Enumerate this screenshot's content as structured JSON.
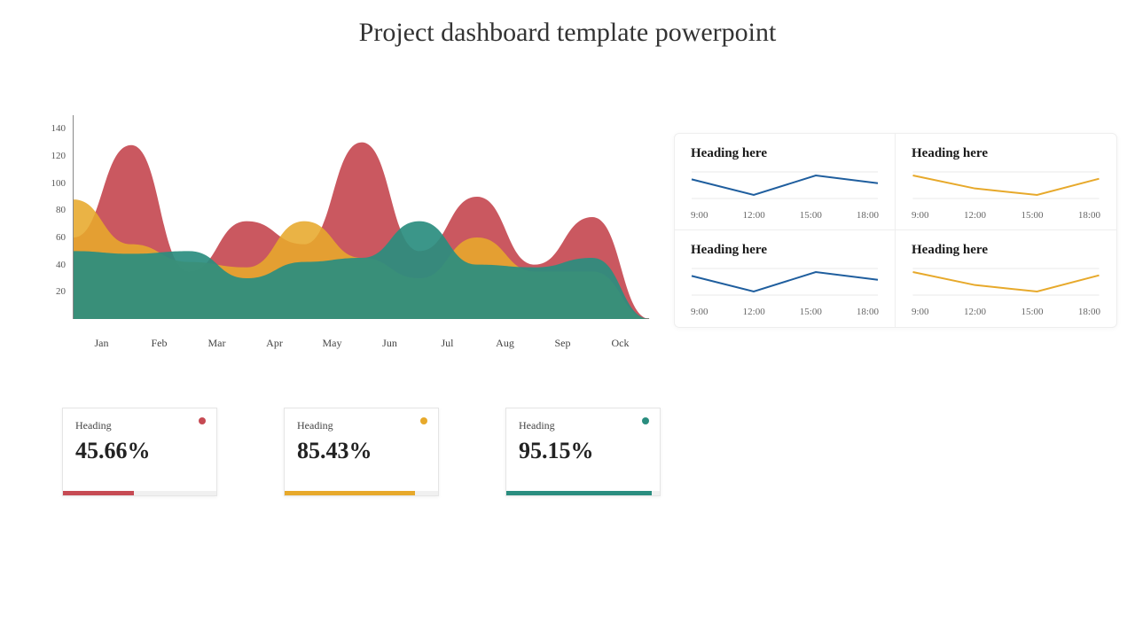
{
  "title": "Project dashboard template powerpoint",
  "colors": {
    "red": "#c64a53",
    "yellow": "#e7a92b",
    "teal": "#2a8d7f",
    "blue": "#1f5e9e"
  },
  "chart_data": [
    {
      "type": "area",
      "title": "",
      "xlabel": "",
      "ylabel": "",
      "ylim": [
        0,
        150
      ],
      "categories": [
        "Jan",
        "Feb",
        "Mar",
        "Apr",
        "May",
        "Jun",
        "Jul",
        "Aug",
        "Sep",
        "Ock"
      ],
      "series": [
        {
          "name": "Red",
          "color": "#c64a53",
          "values": [
            60,
            128,
            35,
            72,
            55,
            130,
            50,
            90,
            40,
            75,
            0
          ]
        },
        {
          "name": "Yellow",
          "color": "#e7a92b",
          "values": [
            88,
            55,
            42,
            38,
            72,
            45,
            30,
            60,
            35,
            35,
            0
          ]
        },
        {
          "name": "Teal",
          "color": "#2a8d7f",
          "values": [
            50,
            48,
            50,
            30,
            42,
            45,
            72,
            40,
            38,
            45,
            0
          ]
        }
      ]
    },
    {
      "type": "line",
      "title": "Heading here",
      "x": [
        "9:00",
        "12:00",
        "15:00",
        "18:00"
      ],
      "values": [
        22,
        14,
        24,
        20
      ],
      "color": "#1f5e9e"
    },
    {
      "type": "line",
      "title": "Heading here",
      "x": [
        "9:00",
        "12:00",
        "15:00",
        "18:00"
      ],
      "values": [
        24,
        16,
        12,
        22
      ],
      "color": "#e7a92b"
    },
    {
      "type": "line",
      "title": "Heading here",
      "x": [
        "9:00",
        "12:00",
        "15:00",
        "18:00"
      ],
      "values": [
        22,
        14,
        24,
        20
      ],
      "color": "#1f5e9e"
    },
    {
      "type": "line",
      "title": "Heading here",
      "x": [
        "9:00",
        "12:00",
        "15:00",
        "18:00"
      ],
      "values": [
        24,
        16,
        12,
        22
      ],
      "color": "#e7a92b"
    }
  ],
  "main_chart": {
    "yticks": [
      "140",
      "120",
      "100",
      "80",
      "60",
      "40",
      "20"
    ]
  },
  "kpis": [
    {
      "label": "Heading",
      "value": "45.66%",
      "pct": 46,
      "color": "#c64a53"
    },
    {
      "label": "Heading",
      "value": "85.43%",
      "pct": 85,
      "color": "#e7a92b"
    },
    {
      "label": "Heading",
      "value": "95.15%",
      "pct": 95,
      "color": "#2a8d7f"
    }
  ],
  "sparks": [
    {
      "heading": "Heading here",
      "times": [
        "9:00",
        "12:00",
        "15:00",
        "18:00"
      ],
      "color": "#1f5e9e",
      "points": [
        22,
        14,
        24,
        20
      ]
    },
    {
      "heading": "Heading here",
      "times": [
        "9:00",
        "12:00",
        "15:00",
        "18:00"
      ],
      "color": "#e7a92b",
      "points": [
        24,
        16,
        12,
        22
      ]
    },
    {
      "heading": "Heading here",
      "times": [
        "9:00",
        "12:00",
        "15:00",
        "18:00"
      ],
      "color": "#1f5e9e",
      "points": [
        22,
        14,
        24,
        20
      ]
    },
    {
      "heading": "Heading here",
      "times": [
        "9:00",
        "12:00",
        "15:00",
        "18:00"
      ],
      "color": "#e7a92b",
      "points": [
        24,
        16,
        12,
        22
      ]
    }
  ]
}
